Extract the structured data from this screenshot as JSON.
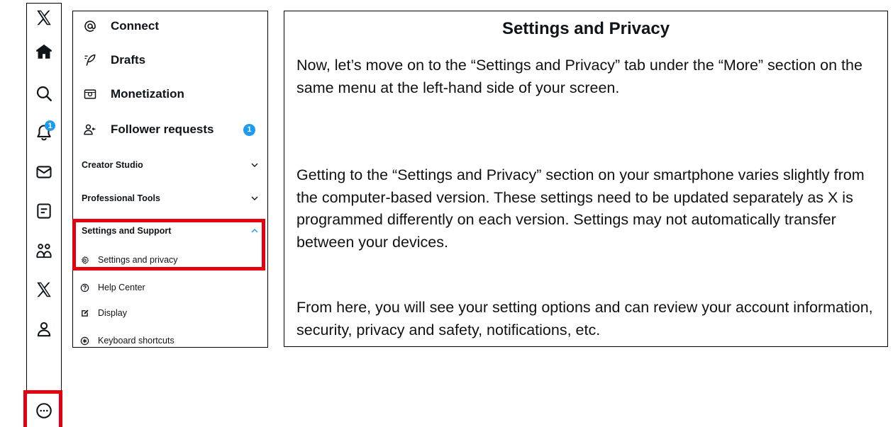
{
  "rail": {
    "icons": [
      "x-logo-icon",
      "home-icon",
      "search-icon",
      "notifications-icon",
      "messages-icon",
      "lists-icon",
      "communities-icon",
      "premium-x-icon",
      "profile-icon",
      "more-icon"
    ],
    "notification_count": "1"
  },
  "menu": {
    "connect": "Connect",
    "drafts": "Drafts",
    "monetization": "Monetization",
    "follower_requests": "Follower requests",
    "follower_requests_count": "1",
    "creator_studio": "Creator Studio",
    "professional_tools": "Professional Tools",
    "settings_and_support": "Settings and Support",
    "settings_and_privacy": "Settings and privacy",
    "help_center": "Help Center",
    "display": "Display",
    "keyboard_shortcuts": "Keyboard shortcuts"
  },
  "content": {
    "title": "Settings and Privacy",
    "paragraph1": "Now, let’s move on to the “Settings and Privacy” tab under the “More” section on the same menu at the left-hand side of your screen.",
    "paragraph2": "Getting to the “Settings and Privacy” section on your smartphone varies slightly from the computer-based version. These settings need to be updated separately as X is programmed differently on each version. Settings may not automatically transfer between your devices.",
    "paragraph3": "From here, you will see your setting options and can review your account information, security, privacy and safety, notifications, etc."
  },
  "colors": {
    "highlight": "#e3000f",
    "accent_blue": "#1d9bf0",
    "text": "#0f1419"
  }
}
